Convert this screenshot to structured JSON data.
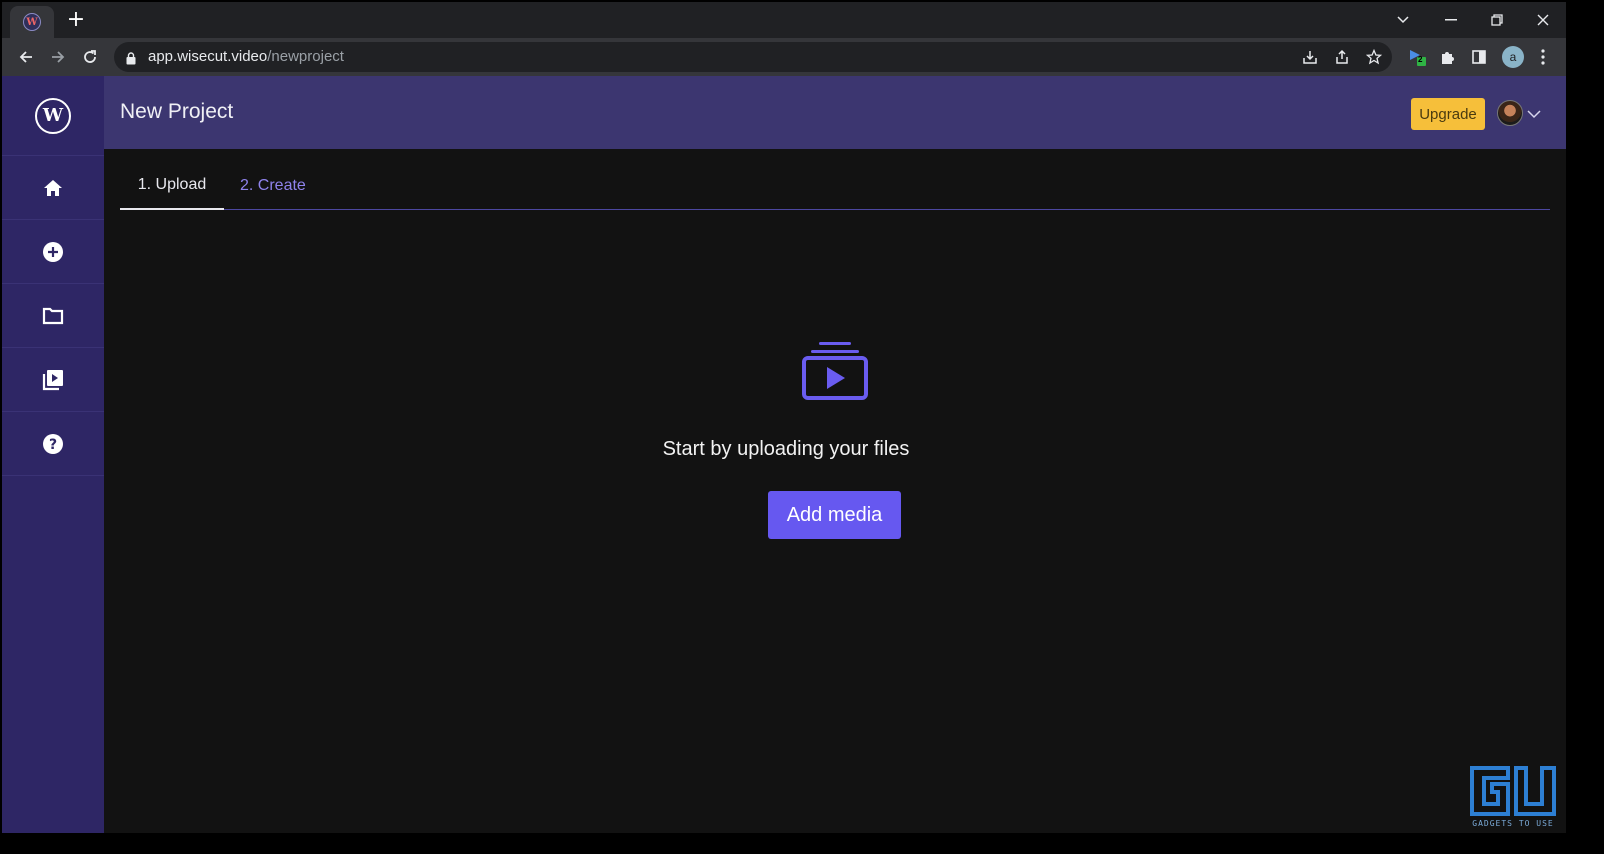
{
  "browser": {
    "tab_favicon_letter": "W",
    "new_tab_symbol": "+",
    "url_host": "app.wisecut.video",
    "url_path": "/newproject",
    "profile_initial": "a",
    "extension_badge": "2",
    "icons": [
      "back-icon",
      "forward-icon",
      "reload-icon",
      "lock-icon",
      "install-icon",
      "share-icon",
      "star-icon",
      "puzzle-icon",
      "sidepanel-icon",
      "menu-icon",
      "minimize-icon",
      "restore-icon",
      "close-icon",
      "tab-search-icon"
    ]
  },
  "app": {
    "logo_letter": "W",
    "page_title": "New Project",
    "upgrade_label": "Upgrade",
    "sidebar": {
      "items": [
        {
          "name": "home",
          "icon": "home-icon"
        },
        {
          "name": "new",
          "icon": "plus-circle-icon"
        },
        {
          "name": "projects",
          "icon": "folder-icon"
        },
        {
          "name": "videos",
          "icon": "video-library-icon"
        },
        {
          "name": "help",
          "icon": "help-icon"
        }
      ]
    },
    "tabs": [
      {
        "label": "1. Upload",
        "active": true
      },
      {
        "label": "2. Create",
        "active": false
      }
    ],
    "empty_state": {
      "icon": "media-upload-icon",
      "text": "Start by uploading your files",
      "button_label": "Add media"
    }
  },
  "watermark": {
    "logo": "GU",
    "text": "GADGETS TO USE"
  },
  "colors": {
    "sidebar": "#2e2665",
    "header": "#3c3670",
    "accent": "#6658f0",
    "upgrade": "#f6bf3a",
    "background": "#121212"
  }
}
